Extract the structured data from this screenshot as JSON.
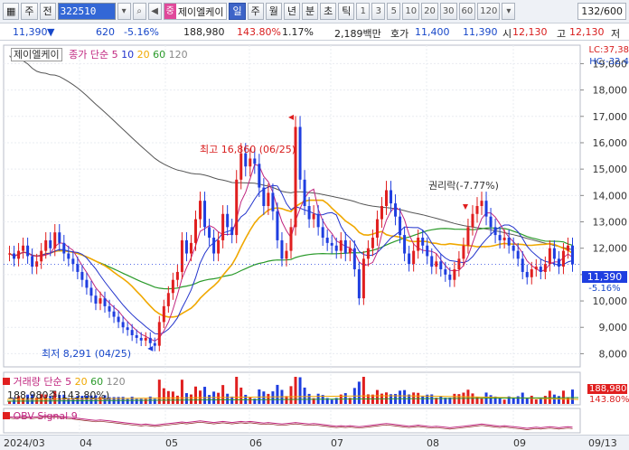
{
  "toolbar": {
    "window_icon": "chart-window-icon",
    "type_label": "주",
    "prev_label": "전",
    "code_value": "322510",
    "stock_tag": "중",
    "stock_name": "제이엘케이",
    "periods": [
      "일",
      "주",
      "월",
      "년",
      "분",
      "초",
      "틱"
    ],
    "active_period": "일",
    "intervals": [
      "1",
      "3",
      "5",
      "10",
      "20",
      "30",
      "60",
      "120"
    ],
    "count": "132/600"
  },
  "quote": {
    "price": "11,390",
    "change": "620",
    "change_pct": "-5.16%",
    "volume": "188,980",
    "volume_pct": "143.80%",
    "turnover_rate": "1.17%",
    "amount": "2,189백만",
    "ask_label": "호가",
    "ask_price": "11,400",
    "bid_price": "11,390",
    "open_label": "시",
    "open": "12,130",
    "high_label": "고",
    "high": "12,130",
    "low_label": "저"
  },
  "legend": {
    "price_name": "제이엘케이",
    "ma_label": "종가 단순",
    "ma_periods": [
      "5",
      "10",
      "20",
      "60",
      "120"
    ],
    "volume_name": "거래량",
    "volume_ma_label": "단순",
    "volume_value": "188,980주(143.80%)",
    "obv_name": "OBV",
    "obv_signal": "Signal 9"
  },
  "right_axis": {
    "lc": "LC:37,38",
    "hc": "HC:-32.4",
    "ticks": [
      "19,000",
      "18,000",
      "17,000",
      "16,000",
      "15,000",
      "14,000",
      "13,000",
      "12,000",
      "11,000",
      "10,000",
      "9,000",
      "8,000"
    ],
    "tick_values": [
      19000,
      18000,
      17000,
      16000,
      15000,
      14000,
      13000,
      12000,
      11000,
      10000,
      9000,
      8000
    ],
    "last_price": "11,390",
    "last_pct": "-5.16%",
    "vol_last": "188,980",
    "vol_pct": "143.80%"
  },
  "annotations": {
    "high": "최고 16,860 (06/25)",
    "low": "최저 8,291 (04/25)",
    "rights": "권리락(-7.77%)"
  },
  "time_axis": [
    "2024/03",
    "04",
    "05",
    "06",
    "07",
    "08",
    "09",
    "09/13"
  ],
  "colors": {
    "up": "#e01f1f",
    "down": "#1f3ee0",
    "ma5": "#c0267f",
    "ma10": "#2233cc",
    "ma20": "#f0a800",
    "ma60": "#2a9a2a",
    "ma120": "#555555"
  },
  "chart_data": {
    "type": "candlestick",
    "y_range": [
      7500,
      19700
    ],
    "high": 16860,
    "low": 8291,
    "last": 11390,
    "closes": [
      11800,
      11600,
      11900,
      12100,
      11700,
      11300,
      11500,
      11900,
      12300,
      12000,
      12600,
      12200,
      11800,
      11600,
      11400,
      11100,
      10800,
      10500,
      10200,
      9900,
      10100,
      9800,
      9600,
      9400,
      9200,
      9000,
      8900,
      8700,
      8600,
      8500,
      8600,
      8400,
      8300,
      9200,
      9800,
      10300,
      10800,
      11100,
      12300,
      11800,
      12200,
      13100,
      13800,
      12800,
      12400,
      11800,
      12300,
      13300,
      12800,
      12500,
      14600,
      15600,
      15100,
      15400,
      15200,
      14300,
      13600,
      14100,
      13400,
      12300,
      11600,
      11900,
      12800,
      16600,
      14600,
      13600,
      13100,
      13300,
      12800,
      12400,
      12200,
      12100,
      11900,
      12300,
      11800,
      12000,
      11200,
      10100,
      11600,
      12000,
      12400,
      13100,
      13600,
      14200,
      13700,
      13200,
      12500,
      11800,
      11400,
      11900,
      12400,
      12100,
      11700,
      11300,
      11500,
      11200,
      11000,
      10800,
      11200,
      11600,
      12100,
      12800,
      13300,
      13600,
      13800,
      13200,
      12800,
      12500,
      12300,
      12400,
      12100,
      11900,
      11600,
      11100,
      10900,
      11200,
      11300,
      11100,
      11400,
      12000,
      11600,
      11300,
      11900,
      12100,
      11390
    ],
    "volume_pct_last": "143.80%"
  }
}
